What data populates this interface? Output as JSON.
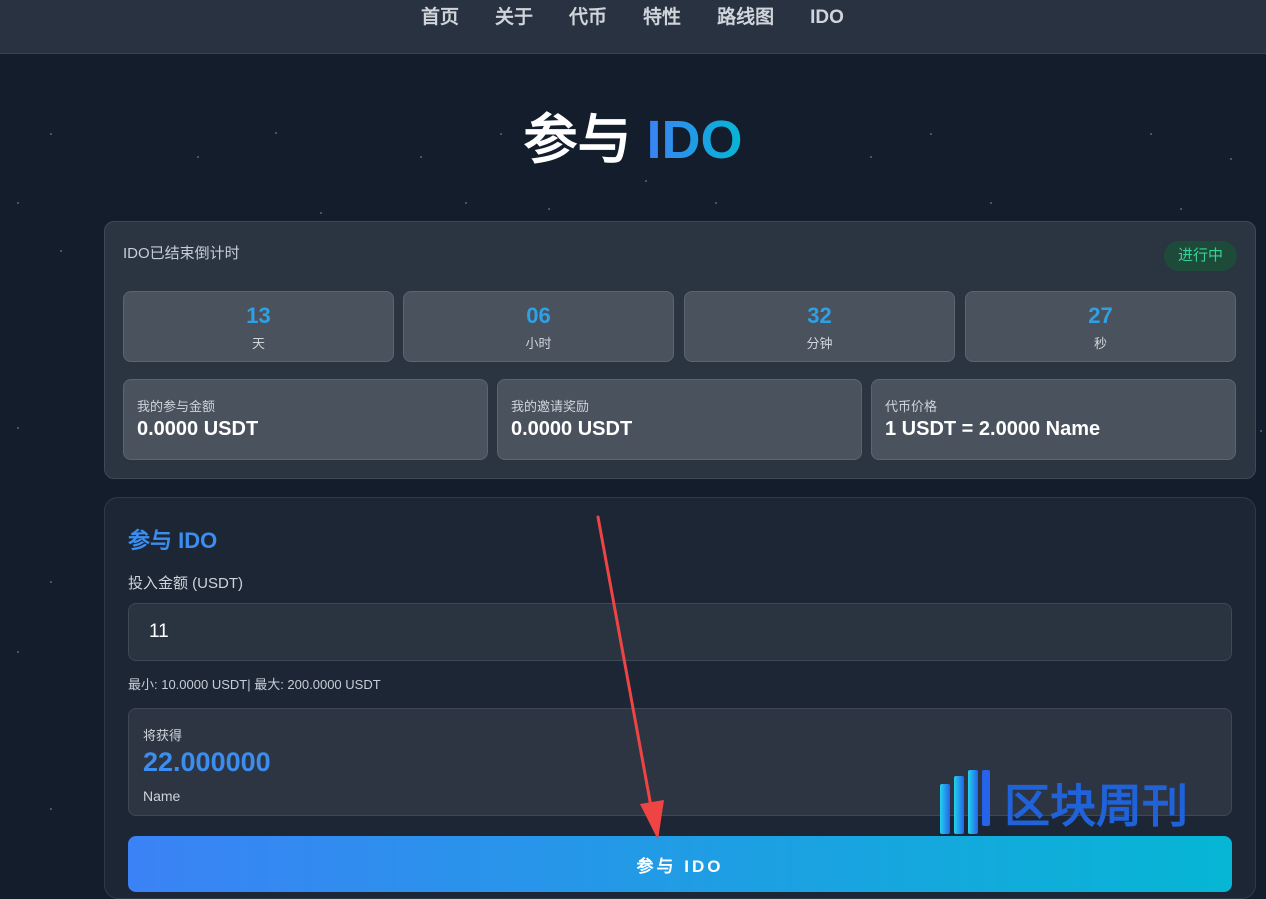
{
  "nav": {
    "items": [
      "首页",
      "关于",
      "代币",
      "特性",
      "路线图",
      "IDO"
    ]
  },
  "hero": {
    "title_main": "参与",
    "title_accent": "IDO"
  },
  "status": {
    "countdown_label": "IDO已结束倒计时",
    "badge": "进行中",
    "countdown": [
      {
        "value": "13",
        "unit": "天"
      },
      {
        "value": "06",
        "unit": "小时"
      },
      {
        "value": "32",
        "unit": "分钟"
      },
      {
        "value": "27",
        "unit": "秒"
      }
    ],
    "stats": [
      {
        "label": "我的参与金额",
        "value": "0.0000 USDT"
      },
      {
        "label": "我的邀请奖励",
        "value": "0.0000 USDT"
      },
      {
        "label": "代币价格",
        "value": "1 USDT = 2.0000 Name"
      }
    ]
  },
  "form": {
    "title": "参与 IDO",
    "amount_label": "投入金额 (USDT)",
    "amount_value": "11",
    "limits": "最小: 10.0000 USDT| 最大: 200.0000 USDT",
    "receive_label": "将获得",
    "receive_value": "22.000000",
    "receive_unit": "Name",
    "submit_label": "参与 IDO"
  },
  "watermark": {
    "text": "区块周刊"
  },
  "colors": {
    "accent_blue": "#3b82f6",
    "accent_cyan": "#06b6d4",
    "badge_green": "#34d399",
    "annotation_red": "#ef4444"
  }
}
